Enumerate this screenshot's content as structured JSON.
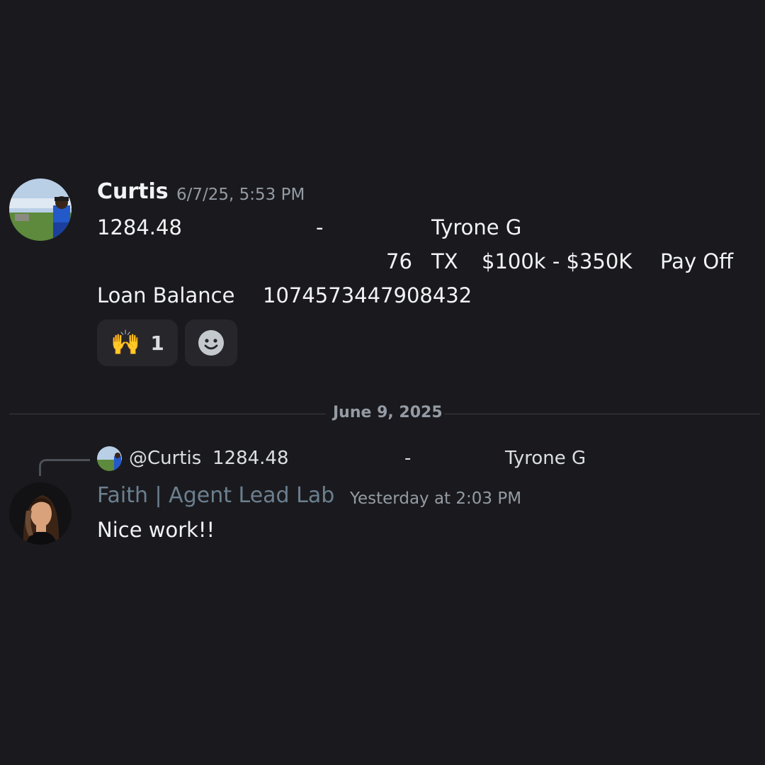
{
  "message_1": {
    "author": "Curtis",
    "timestamp": "6/7/25, 5:53 PM",
    "line1": {
      "amount": "1284.48",
      "dash": "-",
      "name": "Tyrone G"
    },
    "line2": {
      "age": "76",
      "state": "TX",
      "range": "$100k - $350K",
      "type": "Pay Off"
    },
    "line3": {
      "label": "Loan Balance",
      "value": "1074573447908432"
    },
    "reactions": [
      {
        "emoji": "🙌",
        "count": "1"
      }
    ],
    "add_reaction_icon": "smiley-face-icon"
  },
  "date_divider": "June 9, 2025",
  "message_2": {
    "reply_to": {
      "mention": "@Curtis",
      "amount": "1284.48",
      "dash": "-",
      "name": "Tyrone G"
    },
    "author": "Faith | Agent Lead Lab",
    "author_color": "#6b7f8f",
    "timestamp": "Yesterday at 2:03 PM",
    "text": "Nice work!!"
  },
  "colors": {
    "background": "#1a1a1e",
    "text": "#f2f3f5",
    "muted": "#949ba4",
    "reaction_bg": "#26262b"
  }
}
